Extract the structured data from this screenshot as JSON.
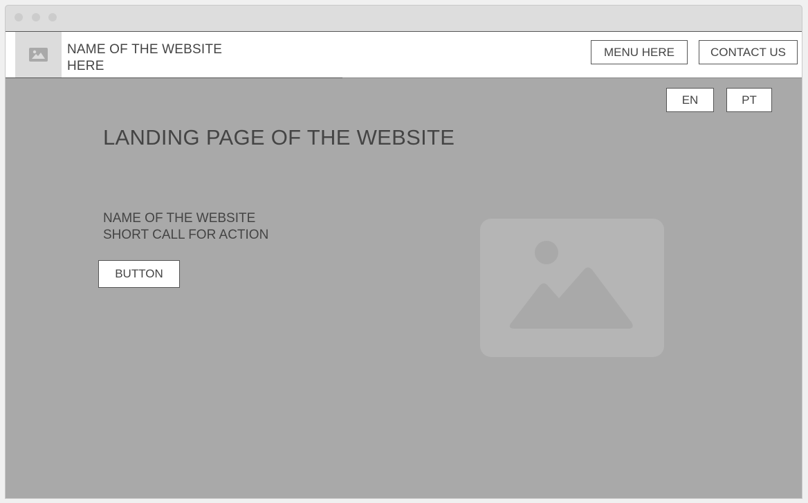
{
  "header": {
    "site_name_line1": "NAME OF THE WEBSITE",
    "site_name_line2": "HERE",
    "menu_label": "MENU HERE",
    "contact_label": "CONTACT US",
    "logo_icon": "image-placeholder-icon"
  },
  "language": {
    "en_label": "EN",
    "pt_label": "PT"
  },
  "main": {
    "title": "LANDING PAGE OF THE WEBSITE",
    "site_name": "NAME OF THE WEBSITE",
    "call_to_action": "SHORT CALL FOR ACTION",
    "button_label": "BUTTON",
    "hero_icon": "image-placeholder-icon"
  },
  "colors": {
    "background": "#a9a9a9",
    "header_bg": "#ffffff",
    "titlebar": "#dddddd",
    "text": "#444444",
    "placeholder": "#b5b5b5"
  }
}
